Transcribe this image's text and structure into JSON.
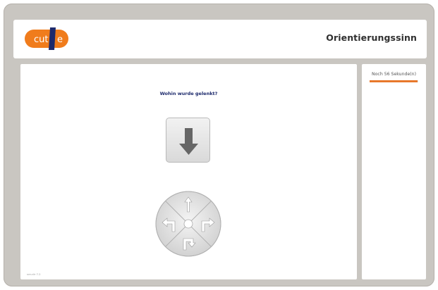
{
  "header": {
    "logo_text": "cut-e",
    "title": "Orientierungssinn"
  },
  "task": {
    "question": "Wohin wurde gelenkt?",
    "shown_arrow": "arrow-down-icon",
    "answer_options": [
      {
        "name": "straight",
        "icon": "arrow-straight-icon"
      },
      {
        "name": "turn-right",
        "icon": "turn-right-icon"
      },
      {
        "name": "u-turn",
        "icon": "u-turn-icon"
      },
      {
        "name": "turn-left",
        "icon": "turn-left-icon"
      }
    ]
  },
  "timer": {
    "label": "Noch 56 Sekunde(n)",
    "remaining_fraction": 0.98,
    "color": "#e8782b"
  },
  "footer": {
    "version": "ver-dir 7.2"
  },
  "colors": {
    "frame": "#c9c6c1",
    "logo_orange": "#f07c1c",
    "logo_navy": "#1d2a6c",
    "question_text": "#1d2a6c"
  }
}
